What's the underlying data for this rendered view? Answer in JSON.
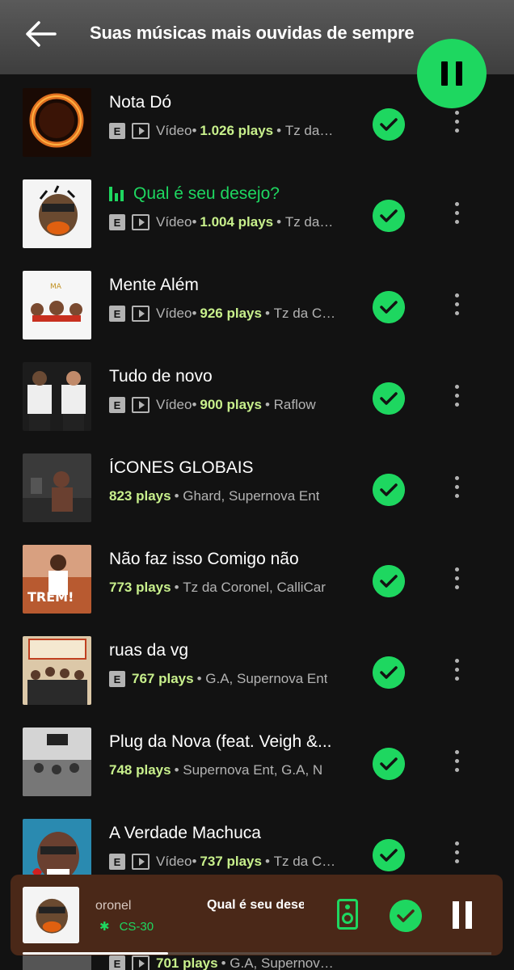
{
  "header": {
    "title": "Suas músicas mais ouvidas de sempre",
    "back_icon": "arrow-left-icon",
    "play_icon": "pause-icon"
  },
  "tracks": [
    {
      "title": "Nota Dó",
      "explicit": "E",
      "type": "Vídeo",
      "plays": "1.026 plays",
      "artists": "Tz da Coronel"
    },
    {
      "title": "Qual é seu desejo?",
      "explicit": "E",
      "type": "Vídeo",
      "plays": "1.004 plays",
      "artists": "Tz da Coronel",
      "playing": true
    },
    {
      "title": "Mente Além",
      "explicit": "E",
      "type": "Vídeo",
      "plays": "926 plays",
      "artists": "Tz da Coronel"
    },
    {
      "title": "Tudo de novo",
      "explicit": "E",
      "type": "Vídeo",
      "plays": "900 plays",
      "artists": "Raflow"
    },
    {
      "title": "ÍCONES GLOBAIS",
      "plays": "823 plays",
      "artists": "Ghard, Supernova Ent"
    },
    {
      "title": "Não faz isso Comigo não",
      "plays": "773 plays",
      "artists": "Tz da Coronel, CalliCar"
    },
    {
      "title": "ruas da vg",
      "explicit": "E",
      "plays": "767 plays",
      "artists": "G.A, Supernova Ent"
    },
    {
      "title": "Plug da Nova (feat. Veigh &...",
      "plays": "748 plays",
      "artists": "Supernova Ent, G.A, N"
    },
    {
      "title": "A Verdade Machuca",
      "explicit": "E",
      "type": "Vídeo",
      "plays": "737 plays",
      "artists": "Tz da Coronel"
    },
    {
      "title": "",
      "explicit": "E",
      "type": "Vídeo",
      "plays": "701 plays",
      "artists": "G.A, Supernova Ent"
    }
  ],
  "player": {
    "artist": "oronel",
    "title": "Qual é seu desejo?",
    "device": "CS-30",
    "device_icon": "bluetooth-icon"
  },
  "colors": {
    "accent": "#1ed760",
    "plays": "#c8f08c",
    "background": "#121212",
    "player_bg": "#4a2818"
  }
}
